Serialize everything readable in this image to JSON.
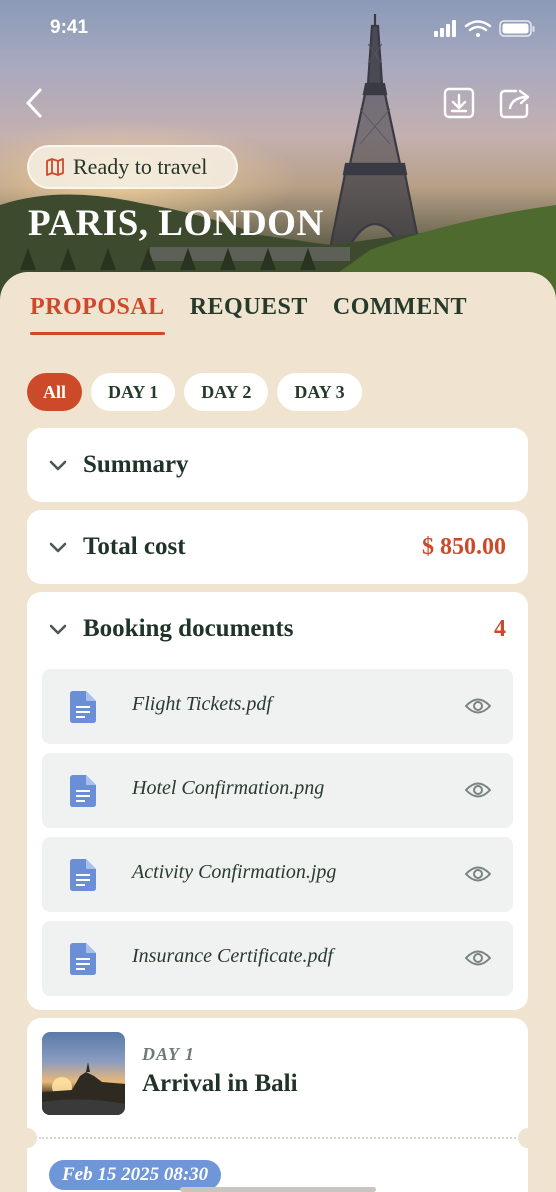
{
  "status_bar": {
    "time": "9:41"
  },
  "header": {
    "badge_label": "Ready to travel",
    "title": "PARIS, LONDON",
    "icons": {
      "back": "chevron-left-icon",
      "download": "download-icon",
      "share": "share-icon",
      "badge": "map-icon"
    }
  },
  "tabs": [
    {
      "label": "PROPOSAL",
      "active": true
    },
    {
      "label": "REQUEST",
      "active": false
    },
    {
      "label": "COMMENT",
      "active": false
    }
  ],
  "day_filters": [
    {
      "label": "All",
      "active": true
    },
    {
      "label": "DAY 1",
      "active": false
    },
    {
      "label": "DAY 2",
      "active": false
    },
    {
      "label": "DAY 3",
      "active": false
    }
  ],
  "summary": {
    "title": "Summary"
  },
  "total_cost": {
    "title": "Total cost",
    "value": "$ 850.00"
  },
  "booking_documents": {
    "title": "Booking documents",
    "count": "4",
    "documents": [
      {
        "name": "Flight Tickets.pdf"
      },
      {
        "name": "Hotel Confirmation.png"
      },
      {
        "name": "Activity Confirmation.jpg"
      },
      {
        "name": "Insurance Certificate.pdf"
      }
    ]
  },
  "day_card": {
    "label": "DAY 1",
    "title": "Arrival in Bali",
    "datetime": "Feb 15 2025 08:30"
  },
  "colors": {
    "accent": "#cc4a2a",
    "text_dark": "#1f3326",
    "background": "#f0e4d0",
    "doc_row": "#eff2f1",
    "date_pill": "#6f96d8"
  }
}
